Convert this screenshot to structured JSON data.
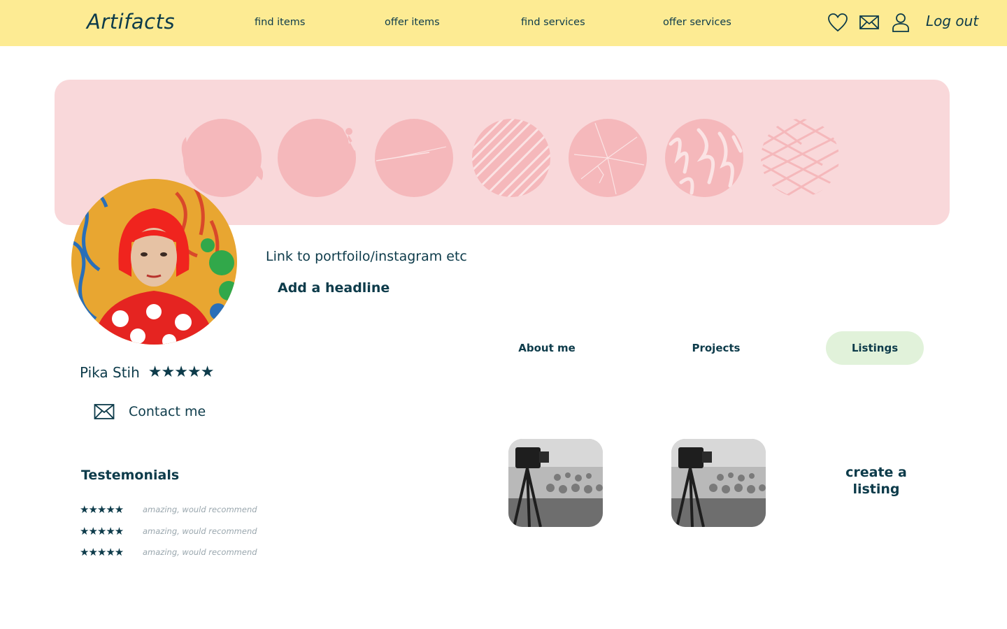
{
  "header": {
    "logo": "Artifacts",
    "nav": [
      "find items",
      "offer items",
      "find services",
      "offer services"
    ],
    "icons": [
      "heart-icon",
      "mail-icon",
      "user-icon"
    ],
    "logout": "Log out"
  },
  "profile": {
    "portfolio_link": "Link to portfoilo/instagram etc",
    "headline": "Add a headline",
    "name": "Pika Stih",
    "rating": "★★★★★",
    "contact": "Contact me"
  },
  "tabs": [
    "About me",
    "Projects",
    "Listings"
  ],
  "active_tab": "Listings",
  "testimonials": {
    "title": "Testemonials",
    "items": [
      {
        "stars": "★★★★★",
        "text": "amazing, would recommend"
      },
      {
        "stars": "★★★★★",
        "text": "amazing, would recommend"
      },
      {
        "stars": "★★★★★",
        "text": "amazing, would recommend"
      }
    ]
  },
  "listings": {
    "create_label": "create a listing"
  },
  "colors": {
    "header_bg": "#fdeb93",
    "banner_bg": "#f9d8da",
    "swatch": "#f5b8bb",
    "text": "#0d3b4a",
    "active_tab_bg": "#e1f2da"
  }
}
